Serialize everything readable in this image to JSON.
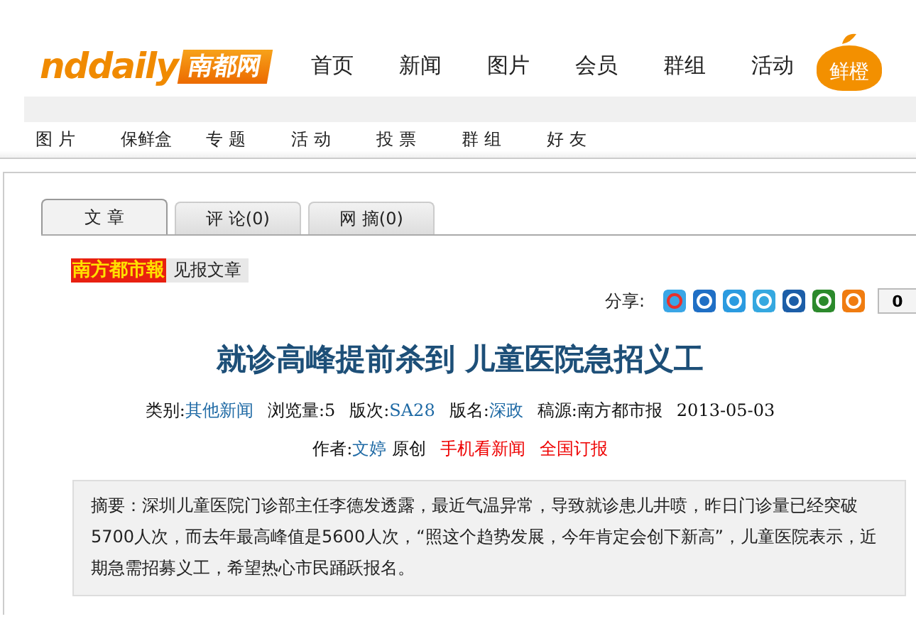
{
  "logo": {
    "latin": "nddaily",
    "chinese": "南都网"
  },
  "nav": [
    "首页",
    "新闻",
    "图片",
    "会员",
    "群组",
    "活动"
  ],
  "badge": "鲜橙",
  "subnav": [
    "图 片",
    "保鲜盒",
    "专 题",
    "活 动",
    "投 票",
    "群 组",
    "好 友"
  ],
  "tabs": [
    {
      "label": "文 章",
      "selected": true
    },
    {
      "label": "评 论(0)",
      "selected": false
    },
    {
      "label": "网 摘(0)",
      "selected": false
    }
  ],
  "paper": {
    "logo": "南方都市報",
    "label": "见报文章"
  },
  "share": {
    "label": "分享:",
    "count": "0"
  },
  "title": "就诊高峰提前杀到 儿童医院急招义工",
  "meta": [
    {
      "kind": "plain",
      "text": "类别:"
    },
    {
      "kind": "link",
      "text": "其他新闻"
    },
    {
      "kind": "gap",
      "text": "浏览量:5"
    },
    {
      "kind": "gap",
      "text": "版次:"
    },
    {
      "kind": "link",
      "text": "SA28"
    },
    {
      "kind": "gap",
      "text": "版名:"
    },
    {
      "kind": "link",
      "text": "深政"
    },
    {
      "kind": "gap",
      "text": "稿源:南方都市报"
    },
    {
      "kind": "gap",
      "text": "2013-05-03"
    }
  ],
  "byline": [
    {
      "kind": "plain",
      "text": "作者:"
    },
    {
      "kind": "link",
      "text": "文婷"
    },
    {
      "kind": "plain",
      "text": " 原创"
    },
    {
      "kind": "promo",
      "text": "手机看新闻"
    },
    {
      "kind": "promo",
      "text": "全国订报"
    }
  ],
  "summary": "摘要：深圳儿童医院门诊部主任李德发透露，最近气温异常，导致就诊患儿井喷，昨日门诊量已经突破5700人次，而去年最高峰值是5600人次，“照这个趋势发展，今年肯定会创下新高”，儿童医院表示，近期急需招募义工，希望热心市民踊跃报名。"
}
